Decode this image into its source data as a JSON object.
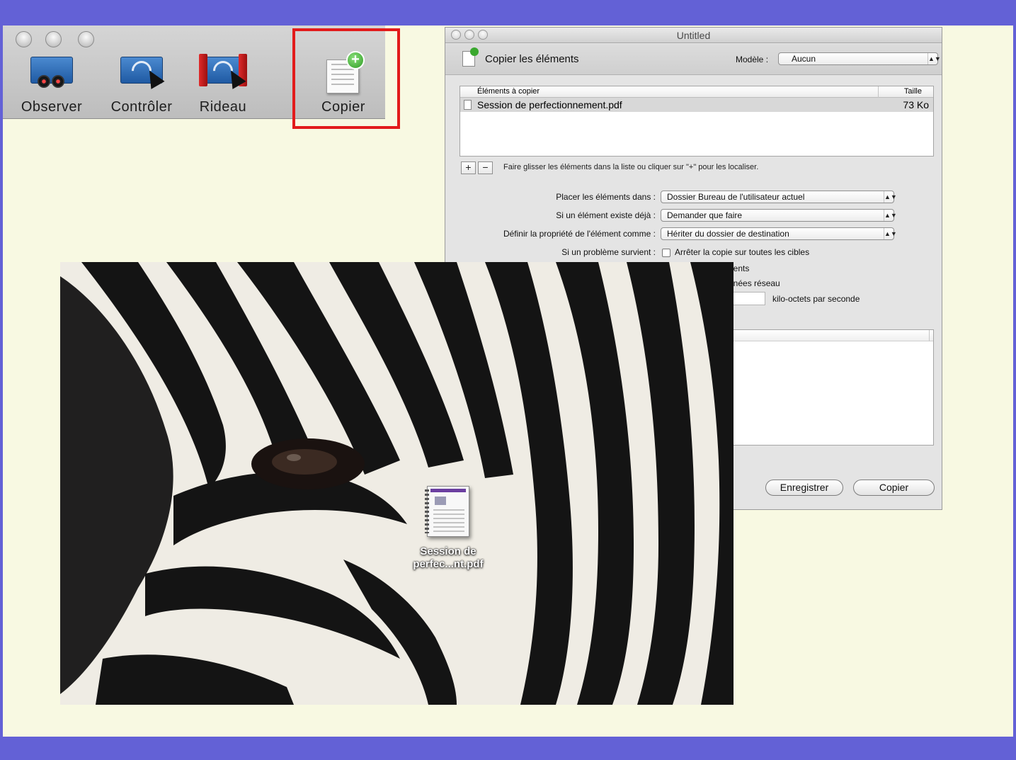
{
  "toolbar": {
    "items": [
      {
        "label": "Observer",
        "icon": "binoculars-screen-icon"
      },
      {
        "label": "Contrôler",
        "icon": "control-screen-icon"
      },
      {
        "label": "Rideau",
        "icon": "curtain-screen-icon"
      },
      {
        "label": "Copier",
        "icon": "copy-document-plus-icon"
      }
    ],
    "highlight_color": "#e21b1b"
  },
  "dialog": {
    "window_title": "Untitled",
    "header_title": "Copier les éléments",
    "model_label": "Modèle :",
    "model_value": "Aucun",
    "list": {
      "col_items": "Éléments à copier",
      "col_size": "Taille",
      "rows": [
        {
          "name": "Session de perfectionnement.pdf",
          "size": "73 Ko"
        }
      ]
    },
    "add_button": "+",
    "remove_button": "−",
    "hint": "Faire glisser les éléments dans la liste ou cliquer sur \"+\" pour les localiser.",
    "place_label": "Placer les éléments dans :",
    "place_value": "Dossier Bureau de l'utilisateur actuel",
    "exists_label": "Si un élément existe déjà :",
    "exists_value": "Demander que faire",
    "ownership_label": "Définir la propriété de l'élément comme :",
    "ownership_value": "Hériter du dossier de destination",
    "problem_label": "Si un problème survient :",
    "problem_option": "Arrêter la copie sur toutes les cibles",
    "partial_option_1": "nents",
    "partial_option_2": "nnées réseau",
    "speed_unit": "kilo-octets par seconde",
    "save_button": "Enregistrer",
    "copy_button": "Copier"
  },
  "desktop": {
    "file_icon_label_line1": "Session de",
    "file_icon_label_line2": "perfec...nt.pdf"
  },
  "colors": {
    "slide_band": "#6361d6",
    "slide_background": "#f8f9e2"
  }
}
